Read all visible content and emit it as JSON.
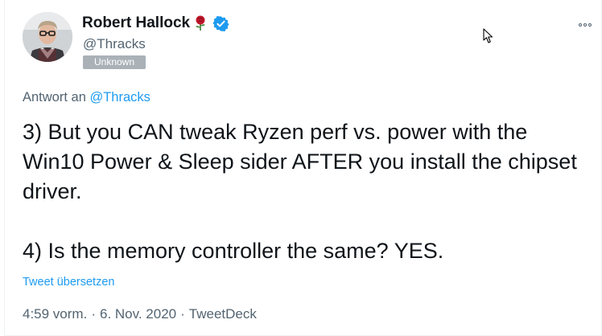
{
  "author": {
    "display_name": "Robert Hallock",
    "name_emoji": "rose-icon",
    "verified": true,
    "verified_icon": "verified-badge-icon",
    "handle": "@Thracks",
    "label_badge": "Unknown"
  },
  "more_menu_icon": "more-horizontal-icon",
  "reply": {
    "prefix": "Antwort an",
    "handle": "@Thracks"
  },
  "tweet_text": "3) But you CAN tweak Ryzen perf vs. power with the Win10 Power & Sleep sider AFTER you install the chipset driver.\n\n4) Is the memory controller the same? YES.",
  "translate_label": "Tweet übersetzen",
  "meta": {
    "time": "4:59 vorm.",
    "separator": "·",
    "date": "6. Nov. 2020",
    "source": "TweetDeck"
  },
  "colors": {
    "accent": "#1d9bf0",
    "secondary_text": "#536471",
    "badge_bg": "#aab2b8",
    "rose": "#c0162b"
  }
}
